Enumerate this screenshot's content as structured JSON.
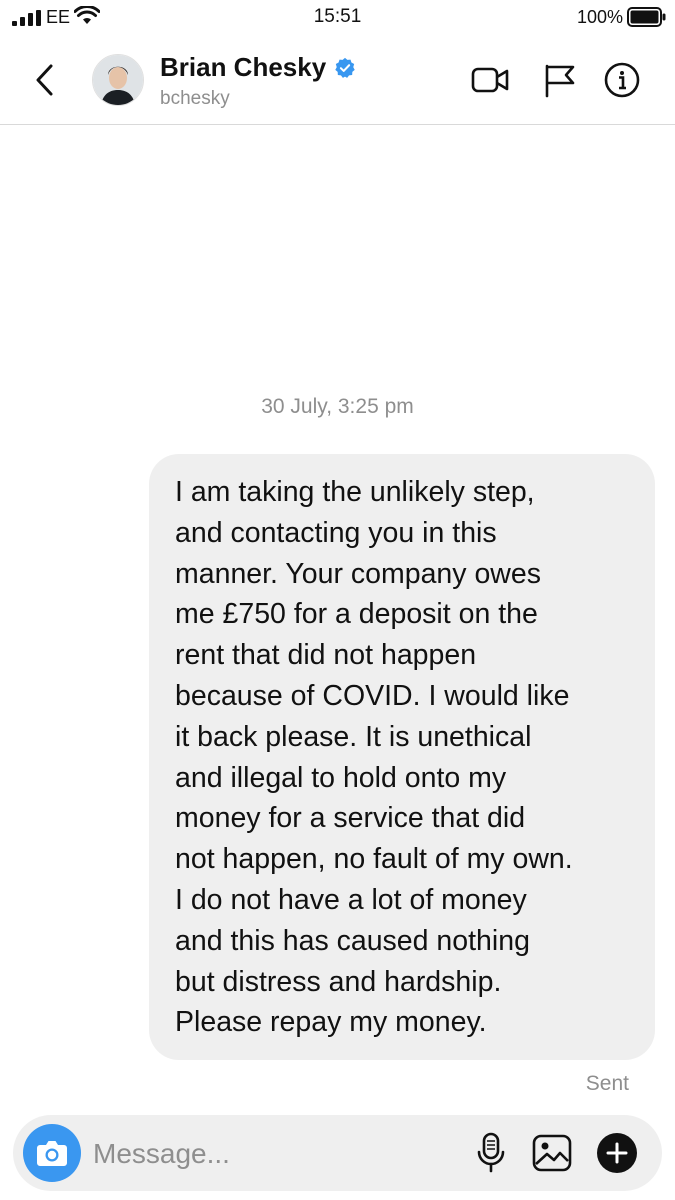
{
  "status_bar": {
    "carrier": "EE",
    "time": "15:51",
    "battery_percent": "100%",
    "battery_level": 1.0,
    "signal_icon": "cellular-signal-icon",
    "wifi_icon": "wifi-icon"
  },
  "header": {
    "name": "Brian Chesky",
    "handle": "bchesky",
    "verified": true,
    "icons": [
      "back-chevron-icon",
      "avatar",
      "verified-badge-icon",
      "video-call-icon",
      "flag-icon",
      "info-icon"
    ]
  },
  "thread": {
    "timestamp": "30 July, 3:25 pm",
    "messages": [
      {
        "from": "me",
        "text": "I am taking the unlikely step,\nand contacting you in this\nmanner.  Your company owes\nme £750 for a deposit on the\nrent that did not happen\nbecause of COVID.  I would like\nit back please.   It is unethical\nand illegal to hold onto my\nmoney for a service that did\nnot happen, no fault of my own.\nI do not have a lot of money\nand this has caused nothing\nbut distress and hardship.\nPlease repay my money.",
        "status": "Sent"
      }
    ]
  },
  "composer": {
    "placeholder": "Message...",
    "value": "",
    "icons": [
      "camera-icon",
      "microphone-icon",
      "gallery-icon",
      "add-icon"
    ]
  },
  "colors": {
    "accent_blue": "#3a97f0",
    "bubble_gray": "#efefef",
    "muted_text": "#8e8e8e",
    "verified_blue": "#3897f0"
  }
}
